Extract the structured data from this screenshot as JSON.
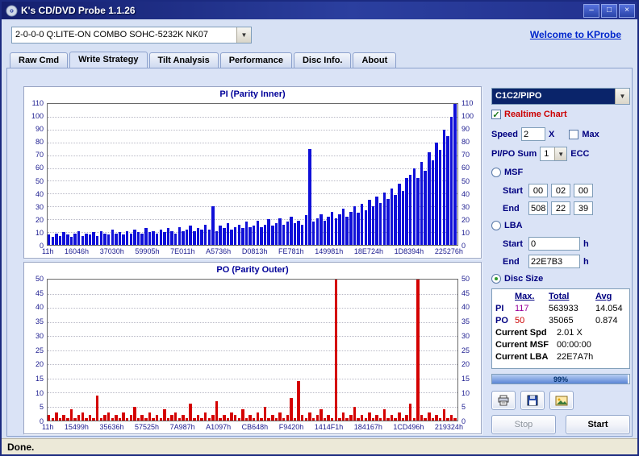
{
  "window": {
    "title": "K's CD/DVD Probe 1.1.26",
    "buttons": {
      "minimize": "–",
      "maximize": "□",
      "close": "×"
    }
  },
  "drive": {
    "value": "2-0-0-0 Q:LITE-ON COMBO SOHC-5232K NK07"
  },
  "link": {
    "label": "Welcome to KProbe"
  },
  "tabs": [
    {
      "label": "Raw Cmd",
      "active": false
    },
    {
      "label": "Write Strategy",
      "active": true
    },
    {
      "label": "Tilt Analysis",
      "active": false
    },
    {
      "label": "Performance",
      "active": false
    },
    {
      "label": "Disc Info.",
      "active": false
    },
    {
      "label": "About",
      "active": false
    }
  ],
  "chart_data": [
    {
      "type": "bar",
      "title": "PI (Parity Inner)",
      "ylim": [
        0,
        110
      ],
      "ytick_step": 10,
      "grid": "horizontal-dotted",
      "series_color": "#1010d8",
      "x_tick_labels": [
        "11h",
        "16046h",
        "37030h",
        "59905h",
        "7E011h",
        "A5736h",
        "D0813h",
        "FE781h",
        "149981h",
        "18E724h",
        "1D8394h",
        "225276h"
      ],
      "values": [
        8,
        6,
        9,
        7,
        10,
        8,
        6,
        9,
        11,
        7,
        9,
        8,
        10,
        7,
        11,
        9,
        8,
        12,
        9,
        10,
        8,
        11,
        9,
        12,
        10,
        9,
        13,
        10,
        11,
        9,
        12,
        10,
        13,
        11,
        9,
        14,
        11,
        12,
        15,
        11,
        13,
        12,
        16,
        12,
        30,
        11,
        15,
        13,
        17,
        12,
        14,
        16,
        13,
        18,
        14,
        15,
        19,
        14,
        16,
        20,
        15,
        17,
        21,
        16,
        18,
        22,
        17,
        19,
        16,
        23,
        75,
        18,
        21,
        24,
        19,
        22,
        26,
        21,
        24,
        28,
        22,
        26,
        30,
        25,
        32,
        27,
        35,
        30,
        38,
        33,
        41,
        36,
        44,
        39,
        48,
        42,
        52,
        55,
        60,
        52,
        65,
        58,
        72,
        66,
        80,
        74,
        90,
        85,
        100,
        110
      ]
    },
    {
      "type": "bar",
      "title": "PO (Parity Outer)",
      "ylim": [
        0,
        50
      ],
      "ytick_step": 5,
      "grid": "horizontal-dotted",
      "series_color": "#d40000",
      "x_tick_labels": [
        "11h",
        "15499h",
        "35636h",
        "57525h",
        "7A987h",
        "A1097h",
        "CB648h",
        "F9420h",
        "1414F1h",
        "184167h",
        "1CD496h",
        "219324h"
      ],
      "values": [
        2,
        1,
        3,
        1,
        2,
        1,
        4,
        1,
        2,
        3,
        1,
        2,
        1,
        9,
        1,
        2,
        3,
        1,
        2,
        1,
        3,
        1,
        2,
        5,
        1,
        2,
        1,
        3,
        1,
        2,
        1,
        4,
        1,
        2,
        3,
        1,
        2,
        1,
        6,
        1,
        2,
        1,
        3,
        1,
        2,
        7,
        1,
        2,
        1,
        3,
        2,
        1,
        4,
        1,
        2,
        1,
        3,
        1,
        5,
        1,
        2,
        1,
        3,
        1,
        2,
        8,
        1,
        14,
        2,
        1,
        3,
        1,
        2,
        4,
        1,
        2,
        1,
        50,
        1,
        3,
        1,
        2,
        5,
        1,
        2,
        1,
        3,
        1,
        2,
        1,
        4,
        1,
        2,
        1,
        3,
        1,
        2,
        6,
        1,
        50,
        2,
        1,
        3,
        1,
        2,
        1,
        4,
        1,
        2,
        1
      ]
    }
  ],
  "panel": {
    "mode_value": "C1C2/PIPO",
    "realtime_label": "Realtime Chart",
    "speed_label": "Speed",
    "speed_value": "2",
    "speed_unit": "X",
    "max_label": "Max",
    "sum_label": "PI/PO Sum",
    "sum_value": "1",
    "sum_unit": "ECC",
    "msf_label": "MSF",
    "start_label": "Start",
    "end_label": "End",
    "msf_start": [
      "00",
      "02",
      "00"
    ],
    "msf_end": [
      "508",
      "22",
      "39"
    ],
    "lba_label": "LBA",
    "lba_start": "0",
    "lba_end": "22E7B3",
    "hex_unit": "h",
    "disc_label": "Disc Size"
  },
  "stats": {
    "headers": [
      "Max.",
      "Total",
      "Avg"
    ],
    "rows": [
      {
        "label": "PI",
        "max": "117",
        "total": "563933",
        "avg": "14.054",
        "max_color": "#990099"
      },
      {
        "label": "PO",
        "max": "50",
        "total": "35065",
        "avg": "0.874",
        "max_color": "#cc0000"
      }
    ],
    "current": [
      {
        "label": "Current Spd",
        "value": "2.01 X"
      },
      {
        "label": "Current MSF",
        "value": "00:00:00"
      },
      {
        "label": "Current LBA",
        "value": "22E7A7h"
      }
    ]
  },
  "progress": {
    "percent": 99,
    "label": "99%"
  },
  "actions": {
    "stop": "Stop",
    "start": "Start"
  },
  "statusbar": {
    "text": "Done."
  }
}
